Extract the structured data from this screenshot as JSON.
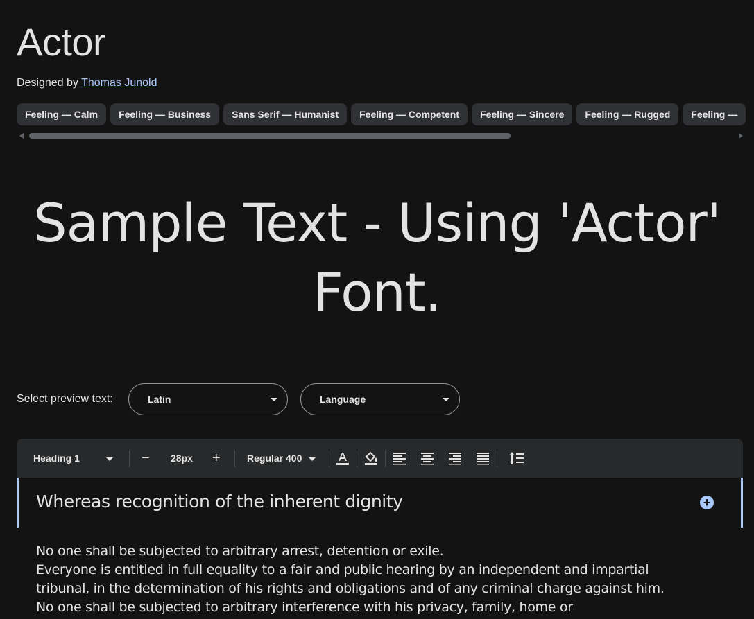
{
  "font": {
    "name": "Actor",
    "designed_by_label": "Designed by",
    "designer": "Thomas Junold"
  },
  "tags": [
    "Feeling — Calm",
    "Feeling — Business",
    "Sans Serif — Humanist",
    "Feeling — Competent",
    "Feeling — Sincere",
    "Feeling — Rugged",
    "Feeling —"
  ],
  "sample_text": "Sample Text - Using 'Actor' Font.",
  "preview": {
    "label": "Select preview text:",
    "script_value": "Latin",
    "language_value": "Language"
  },
  "toolbar": {
    "style": "Heading 1",
    "size": "28px",
    "weight": "Regular 400",
    "decrease": "−",
    "increase": "+"
  },
  "editor": {
    "heading": "Whereas recognition of the inherent dignity",
    "body_lines": [
      "No one shall be subjected to arbitrary arrest, detention or exile.",
      "Everyone is entitled in full equality to a fair and public hearing by an independent and impartial",
      "tribunal, in the determination of his rights and obligations and of any criminal charge against him.",
      "No one shall be subjected to arbitrary interference with his privacy, family, home or"
    ]
  },
  "colors": {
    "background": "#131314",
    "chip": "#303134",
    "accent": "#a8c7fa",
    "text": "#e3e3e3"
  }
}
